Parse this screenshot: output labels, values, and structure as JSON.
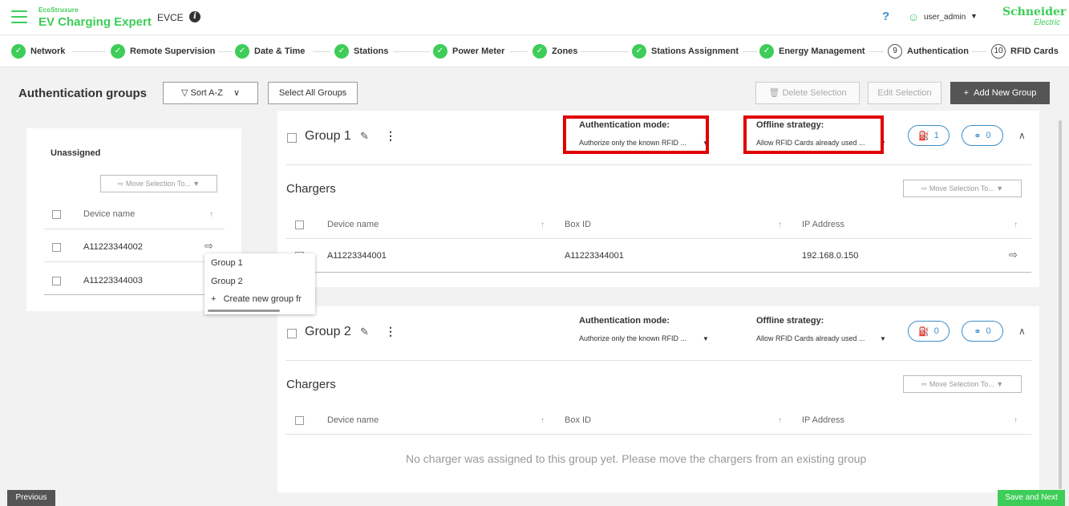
{
  "header": {
    "brand_top": "EcoStruxure",
    "brand_main": "EV Charging Expert",
    "site": "EVCE",
    "help": "?",
    "user": "user_admin",
    "logo_line1": "Schneider",
    "logo_line2": "Electric"
  },
  "stepper": [
    {
      "label": "Network",
      "state": "done"
    },
    {
      "label": "Remote Supervision",
      "state": "done"
    },
    {
      "label": "Date & Time",
      "state": "done"
    },
    {
      "label": "Stations",
      "state": "done"
    },
    {
      "label": "Power Meter",
      "state": "done"
    },
    {
      "label": "Zones",
      "state": "done"
    },
    {
      "label": "Stations Assignment",
      "state": "done"
    },
    {
      "label": "Energy Management",
      "state": "done"
    },
    {
      "label": "Authentication",
      "state": "current",
      "number": "9"
    },
    {
      "label": "RFID Cards",
      "state": "todo",
      "number": "10"
    }
  ],
  "toolbar": {
    "title": "Authentication groups",
    "sort": "Sort A-Z",
    "select_all": "Select All Groups",
    "delete": "Delete Selection",
    "edit": "Edit Selection",
    "add": "Add New Group"
  },
  "unassigned": {
    "title": "Unassigned",
    "move": "Move Selection To...",
    "col": "Device name",
    "rows": [
      "A11223344002",
      "A11223344003"
    ]
  },
  "menu": {
    "items": [
      "Group 1",
      "Group 2",
      "Create new group fr"
    ]
  },
  "groups": [
    {
      "name": "Group 1",
      "auth_label": "Authentication mode:",
      "auth_value": "Authorize only the known RFID ...",
      "offline_label": "Offline strategy:",
      "offline_value": "Allow RFID Cards already used ...",
      "chargers_count": "1",
      "cards_count": "0",
      "chargers_title": "Chargers",
      "move": "Move Selection To...",
      "cols": [
        "Device name",
        "Box ID",
        "IP Address"
      ],
      "rows": [
        {
          "device": "A11223344001",
          "box": "A11223344001",
          "ip": "192.168.0.150"
        }
      ]
    },
    {
      "name": "Group 2",
      "auth_label": "Authentication mode:",
      "auth_value": "Authorize only the known RFID ...",
      "offline_label": "Offline strategy:",
      "offline_value": "Allow RFID Cards already used ...",
      "chargers_count": "0",
      "cards_count": "0",
      "chargers_title": "Chargers",
      "move": "Move Selection To...",
      "cols": [
        "Device name",
        "Box ID",
        "IP Address"
      ],
      "empty": "No charger was assigned to this group yet. Please move the chargers from an existing group"
    }
  ],
  "footer": {
    "previous": "Previous",
    "next": "Save and Next"
  },
  "colors": {
    "accent": "#3dcd58",
    "link": "#3d8ec9",
    "highlight": "#e00000"
  }
}
